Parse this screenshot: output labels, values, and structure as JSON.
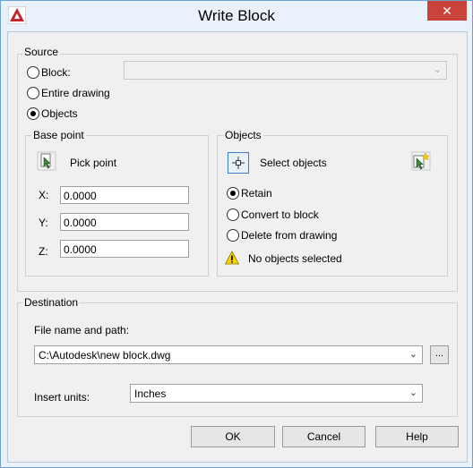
{
  "window": {
    "title": "Write Block",
    "close_glyph": "✕"
  },
  "source": {
    "label": "Source",
    "block_label": "Block:",
    "entire_label": "Entire drawing",
    "objects_label": "Objects",
    "selected": "objects",
    "block_combo_value": ""
  },
  "base_point": {
    "label": "Base point",
    "pick_label": "Pick point",
    "x_label": "X:",
    "y_label": "Y:",
    "z_label": "Z:",
    "x_value": "0.0000",
    "y_value": "0.0000",
    "z_value": "0.0000"
  },
  "objects": {
    "label": "Objects",
    "select_label": "Select objects",
    "retain_label": "Retain",
    "convert_label": "Convert to block",
    "delete_label": "Delete from drawing",
    "selected": "retain",
    "status": "No objects selected"
  },
  "destination": {
    "label": "Destination",
    "file_label": "File name and path:",
    "file_value": "C:\\Autodesk\\new block.dwg",
    "browse_label": "...",
    "units_label": "Insert units:",
    "units_value": "Inches"
  },
  "buttons": {
    "ok": "OK",
    "cancel": "Cancel",
    "help": "Help"
  },
  "colors": {
    "close_red": "#c8443a",
    "frame": "#e9f1fa",
    "app_red": "#c0282d",
    "warning_yellow": "#f7d400"
  }
}
